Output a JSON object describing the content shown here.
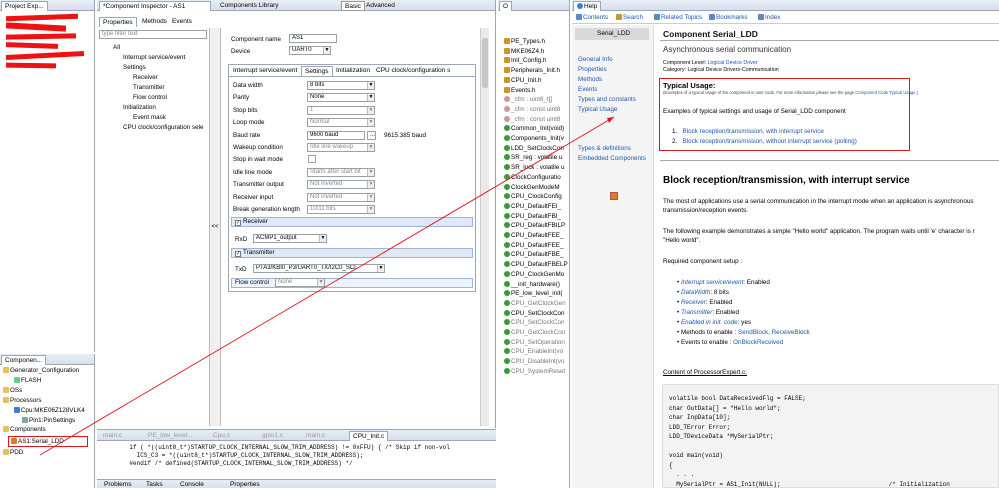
{
  "project_explorer": {
    "tab": "Project Exp...",
    "rows": [
      "",
      "",
      "",
      "",
      "",
      ""
    ]
  },
  "inspector": {
    "tab": "*Component Inspector - AS1",
    "tab2": "Components Library",
    "btn_basic": "Basic",
    "btn_advanced": "Advanced",
    "subtabs": [
      "Properties",
      "Methods",
      "Events"
    ],
    "filter_placeholder": "type filter text",
    "tree": [
      "All",
      "Interrupt service/event",
      "Settings",
      "Receiver",
      "Transmitter",
      "Flow control",
      "Initialization",
      "Event mask",
      "CPU clock/configuration sele"
    ],
    "component_name_label": "Component name",
    "component_name": "AS1",
    "device_label": "Device",
    "device": "UART0",
    "prop_tabs": [
      "Interrupt service/event",
      "Settings",
      "Initialization",
      "CPU clock/configuration s"
    ],
    "props": [
      {
        "label": "Data width",
        "value": "8 bits",
        "dd": true
      },
      {
        "label": "Parity",
        "value": "None",
        "dd": true
      },
      {
        "label": "Stop bits",
        "value": "1",
        "dd": true,
        "gray": true
      },
      {
        "label": "Loop mode",
        "value": "Normal",
        "dd": true,
        "gray": true
      },
      {
        "label": "Baud rate",
        "value": "9600 baud",
        "dd": false,
        "extra": "9615.385 baud"
      },
      {
        "label": "Wakeup condition",
        "value": "Idle line wakeup",
        "dd": true,
        "gray": true
      },
      {
        "label": "Stop in wait mode",
        "value": "",
        "check": true
      },
      {
        "label": "Idle line mode",
        "value": "Starts after start bit",
        "dd": true,
        "gray": true
      },
      {
        "label": "Transmitter output",
        "value": "Not inverted",
        "dd": true,
        "gray": true
      },
      {
        "label": "Receiver input",
        "value": "Not inverted",
        "dd": true,
        "gray": true
      },
      {
        "label": "Break generation length",
        "value": "10/11 bits",
        "dd": true,
        "gray": true
      }
    ],
    "receiver_head": "Receiver",
    "rxd_label": "RxD",
    "rxd": "ACMP1_output",
    "transmitter_head": "Transmitter",
    "txd_label": "TxD",
    "txd": "PTA3/KBI0_P3/UART0_TX/I2C0_SCL",
    "flow_label": "Flow control",
    "flow": "None"
  },
  "components": {
    "tab": "Componen...",
    "items": [
      "Generator_Configuration",
      "FLASH",
      "OSs",
      "Processors",
      "Cpu:MKE06Z128VLK4",
      "Pin1:PinSettings",
      "Components",
      "AS1:Serial_LDD",
      "PDD"
    ]
  },
  "editor": {
    "tabs": [
      "main.c",
      "PE_low_level...",
      "Cpu.c",
      "gpio1.c",
      "main.c",
      "CPU_Init.c"
    ],
    "lines": [
      "    if ( *((uint8_t*)STARTUP_CLOCK_INTERNAL_SLOW_TRIM_ADDRESS) != 0xFFU) { /* Skip if non-vol",
      "      ICS_C3 = *((uint8_t*)STARTUP_CLOCK_INTERNAL_SLOW_TRIM_ADDRESS);",
      "    #endif /* defined(STARTUP_CLOCK_INTERNAL_SLOW_TRIM_ADDRESS) */"
    ]
  },
  "bottom_tabs": [
    "Problems",
    "Tasks",
    "Console",
    "Properties"
  ],
  "outline": {
    "tab": "O",
    "items": [
      "PE_Types.h",
      "MKE06Z4.h",
      "Init_Config.h",
      "Peripherals_Init.h",
      "CPU_Init.h",
      "Events.h",
      "_cfm : uint8_t[]",
      "_cfm : const uint8",
      "_cfm : const uint8",
      "Common_Init(void)",
      "Components_Init(v",
      "LDD_SetClockCon",
      "SR_reg : volatile u",
      "SR_lock : volatile u",
      "ClockConfiguratio",
      "ClockGenModeM",
      "CPU_ClockConfig",
      "CPU_DefaultFEI_",
      "CPU_DefaultFBI_",
      "CPU_DefaultFBILP",
      "CPU_DefaultFEE_",
      "CPU_DefaultFEE_",
      "CPU_DefaultFBE_",
      "CPU_DefaultFBELP",
      "CPU_ClockGenMo",
      "__init_hardware()",
      "PE_low_level_init(",
      "CPU_GetClockGen",
      "CPU_SetClockCon",
      "CPU_SetClockCon",
      "CPU_GetClockCon",
      "CPU_SetOperation",
      "CPU_EnableInt(vo",
      "CPU_DisableInt(vo",
      "CPU_SystemReset"
    ]
  },
  "help": {
    "tab": "Help",
    "toolbar": [
      "Contents",
      "Search",
      "Related Topics",
      "Bookmarks",
      "Index"
    ],
    "nav_title": "Serial_LDD",
    "nav": [
      "General Info",
      "Properties",
      "Methods",
      "Events",
      "Types and constants",
      "Typical Usage",
      "Types & definitions",
      "Embedded Components"
    ],
    "title": "Component Serial_LDD",
    "subtitle": "Asynchronous serial communication",
    "level_label": "Component Level:",
    "level": "Logical Device Driver",
    "category_label": "Category:",
    "category": "Logical Device Drivers-Communication",
    "typical_title": "Typical Usage:",
    "typical_note": "(Examples of a typical usage of the component in user code. For more information please see the page ",
    "typical_note_link": "Component Code Typical Usage.",
    "typical_note_end": ")",
    "examples_intro": "Examples of typical settings and usage of Serial_LDD component",
    "examples": [
      "Block reception/transmission, with interrupt service",
      "Block reception/transmission, without interrupt service (polling)"
    ],
    "h2": "Block reception/transmission, with interrupt service",
    "p1": "The most of applications use a serial communication in the interrupt mode when an application is asynchronous",
    "p1b": "transmission/reception events.",
    "p2": "The following example demonstrates a simple \"Hello world\" application. The program waits until 'e' character is r",
    "p2b": "\"Hello world\".",
    "req": "Required component setup :",
    "setup": [
      {
        "k": "Interrupt service/event",
        "v": ": Enabled"
      },
      {
        "k": "DataWidth",
        "v": ": 8 bits"
      },
      {
        "k": "Receiver",
        "v": ": Enabled"
      },
      {
        "k": "Transmitter",
        "v": ": Enabled"
      },
      {
        "k": "Enabled in init. code",
        "v": ": yes"
      },
      {
        "k": "",
        "v": "Methods to enable : ",
        "links": "SendBlock, ReceiveBlock"
      },
      {
        "k": "",
        "v": "Events to enable : ",
        "links": "OnBlockReceived"
      }
    ],
    "content_title": "Content of ProcessorExpert.c:",
    "code": [
      "volatile bool DataReceivedFlg = FALSE;",
      "char OutData[] = \"Hello world\";",
      "char InpData[10];",
      "LDD_TError Error;",
      "LDD_TDeviceData *MySerialPtr;",
      "",
      "void main(void)",
      "{",
      "  . . .",
      "  MySerialPtr = AS1_Init(NULL);                              /* Initialization"
    ]
  },
  "colors": {
    "highlight_red": "#e0141c",
    "link": "#1a57b4"
  }
}
